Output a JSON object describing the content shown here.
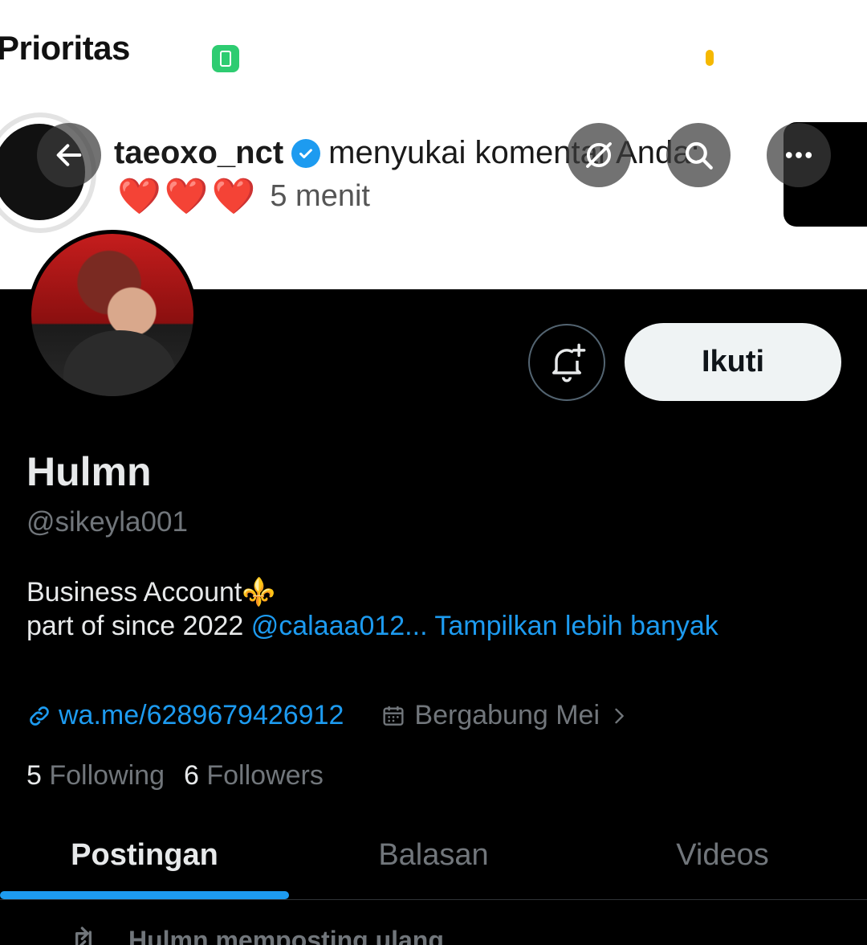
{
  "banner": {
    "priority_text": "Prioritas",
    "notification": {
      "username": "taeoxo_nct",
      "action": "menyukai komentar Anda:",
      "hearts": "❤️❤️❤️",
      "time": "5 menit"
    }
  },
  "header_buttons": {
    "back_icon": "arrow-left-icon",
    "spam_icon": "no-sync-icon",
    "search_icon": "search-icon",
    "more_icon": "more-icon"
  },
  "profile": {
    "follow_label": "Ikuti",
    "name": "Hulmn",
    "handle": "@sikeyla001",
    "bio_line1": "Business Account⚜️",
    "bio_line2_prefix": "part of  since 2022 ",
    "bio_mention": "@calaaa012...",
    "bio_more": " Tampilkan lebih banyak",
    "website": "wa.me/6289679426912",
    "joined": "Bergabung Mei",
    "following_count": "5",
    "following_label": "Following",
    "followers_count": "6",
    "followers_label": "Followers"
  },
  "tabs": [
    {
      "label": "Postingan",
      "active": true
    },
    {
      "label": "Balasan",
      "active": false
    },
    {
      "label": "Videos",
      "active": false
    }
  ],
  "feed": {
    "repost_text": "Hulmn memposting ulang"
  },
  "colors": {
    "accent": "#1d9bf0",
    "background": "#000000",
    "secondary_text": "#71767b"
  }
}
